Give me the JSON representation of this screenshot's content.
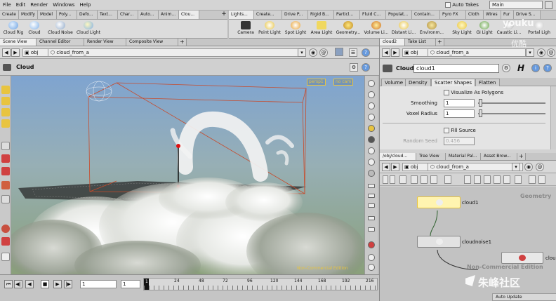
{
  "menu": {
    "items": [
      "File",
      "Edit",
      "Render",
      "Windows",
      "Help"
    ],
    "auto_takes": "Auto Takes",
    "desktop": "Main"
  },
  "shelf_left": {
    "tabs": [
      "Create",
      "Modify",
      "Model",
      "Poly...",
      "Defo...",
      "Text...",
      "Char...",
      "Auto...",
      "Anim...",
      "Clou..."
    ],
    "tools": [
      "Cloud Rig",
      "Cloud",
      "Cloud Noise",
      "Cloud Light"
    ]
  },
  "shelf_right": {
    "tabs": [
      "Lights...",
      "Create...",
      "Drive P...",
      "Rigid B...",
      "Particl...",
      "Fluid C...",
      "Populat...",
      "Contain...",
      "Pyro FX",
      "Cloth",
      "Wires",
      "Fur",
      "Drive S..."
    ],
    "tools": [
      "Camera",
      "Point Light",
      "Spot Light",
      "Area Light",
      "Geometry...",
      "Volume Li...",
      "Distant Li...",
      "Environm...",
      "Sky Light",
      "GI Light",
      "Caustic Li...",
      "Portal Ligh"
    ]
  },
  "scene": {
    "tabs": [
      "Scene View",
      "Channel Editor",
      "Render View",
      "Composite View"
    ],
    "path_root": "obj",
    "path_node": "cloud_from_a",
    "title": "Cloud",
    "persp": "persp1",
    "cam": "no cam",
    "watermark": "Non-Commercial Edition"
  },
  "timeline": {
    "frame": "1",
    "start": "1",
    "ticks": [
      "24",
      "48",
      "72",
      "96",
      "120",
      "144",
      "168",
      "192",
      "216"
    ]
  },
  "params": {
    "tabs": [
      "cloud2",
      "Take List"
    ],
    "path_root": "obj",
    "path_node": "cloud_from_a",
    "node_type": "Cloud",
    "node_name": "cloud1",
    "sub_tabs": [
      "Volume",
      "Density",
      "Scatter Shapes",
      "Flatten"
    ],
    "visualize": "Visualize As Polygons",
    "smoothing_label": "Smoothing",
    "smoothing_value": "1",
    "voxel_label": "Voxel Radius",
    "voxel_value": "1",
    "fill_source": "Fill Source",
    "random_seed_label": "Random Seed",
    "random_seed_value": "0.456"
  },
  "network": {
    "tabs": [
      "/obj/cloud...",
      "Tree View",
      "Material Pal...",
      "Asset Brow..."
    ],
    "path_root": "obj",
    "path_node": "cloud_from_a",
    "context": "Geometry",
    "watermark": "Non-Commercial Edition",
    "nodes": [
      "cloud1",
      "cloudnoise1",
      "clou"
    ]
  },
  "status": {
    "auto_update": "Auto Update"
  },
  "overlay": {
    "logo": "youku",
    "logo_sub": "优酷",
    "brand": "朱峰社区"
  },
  "colors": {
    "accent": "#e8c440",
    "sky_top": "#7fa4d0",
    "sky_bottom": "#8aa07a"
  }
}
